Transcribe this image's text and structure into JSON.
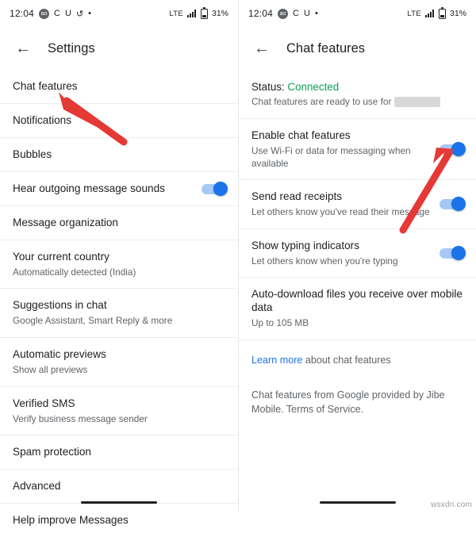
{
  "left_screen": {
    "status_bar": {
      "time": "12:04",
      "badge": "ao",
      "glyphs": [
        "C",
        "U",
        "↺",
        "•"
      ],
      "network": "LTE",
      "battery_percent": "31%"
    },
    "appbar": {
      "back_icon": "back-arrow-icon",
      "title": "Settings"
    },
    "items": [
      {
        "title": "Chat features",
        "sub": "",
        "toggle": null
      },
      {
        "title": "Notifications",
        "sub": "",
        "toggle": null
      },
      {
        "title": "Bubbles",
        "sub": "",
        "toggle": null
      },
      {
        "title": "Hear outgoing message sounds",
        "sub": "",
        "toggle": "on"
      },
      {
        "title": "Message organization",
        "sub": "",
        "toggle": null
      },
      {
        "title": "Your current country",
        "sub": "Automatically detected (India)",
        "toggle": null
      },
      {
        "title": "Suggestions in chat",
        "sub": "Google Assistant, Smart Reply & more",
        "toggle": null
      },
      {
        "title": "Automatic previews",
        "sub": "Show all previews",
        "toggle": null
      },
      {
        "title": "Verified SMS",
        "sub": "Verify business message sender",
        "toggle": null
      },
      {
        "title": "Spam protection",
        "sub": "",
        "toggle": null
      },
      {
        "title": "Advanced",
        "sub": "",
        "toggle": null
      },
      {
        "title": "Help improve Messages",
        "sub": "",
        "toggle": null
      }
    ]
  },
  "right_screen": {
    "status_bar": {
      "time": "12:04",
      "badge": "ao",
      "glyphs": [
        "C",
        "U",
        "•"
      ],
      "network": "LTE",
      "battery_percent": "31%"
    },
    "appbar": {
      "back_icon": "back-arrow-icon",
      "title": "Chat features"
    },
    "status_block": {
      "label": "Status:",
      "value": "Connected",
      "description_prefix": "Chat features are ready to use for",
      "description_redacted": true
    },
    "items": [
      {
        "title": "Enable chat features",
        "sub": "Use Wi-Fi or data for messaging when available",
        "toggle": "on"
      },
      {
        "title": "Send read receipts",
        "sub": "Let others know you've read their message",
        "toggle": "on"
      },
      {
        "title": "Show typing indicators",
        "sub": "Let others know when you're typing",
        "toggle": "on"
      },
      {
        "title": "Auto-download files you receive over mobile data",
        "sub": "Up to 105 MB",
        "toggle": null
      }
    ],
    "learn_more": {
      "link_text": "Learn more",
      "rest_text": " about chat features"
    },
    "footer_text": "Chat features from Google provided by Jibe Mobile. Terms of Service."
  },
  "annotations": {
    "arrow_color": "#e53935",
    "left_arrow": "points at Chat features row",
    "right_arrow": "points at Enable chat features toggle"
  },
  "watermark": "wsxdn.com"
}
